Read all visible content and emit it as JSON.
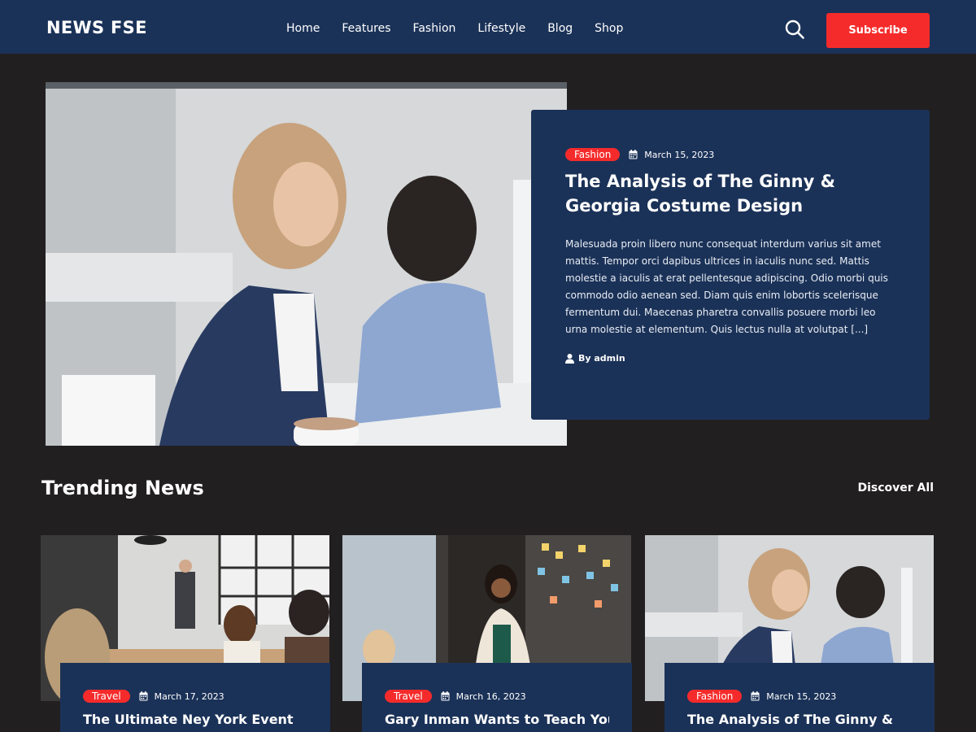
{
  "site": {
    "logo": "NEWS FSE"
  },
  "nav": [
    "Home",
    "Features",
    "Fashion",
    "Lifestyle",
    "Blog",
    "Shop"
  ],
  "header": {
    "subscribe_label": "Subscribe"
  },
  "hero": {
    "category": "Fashion",
    "date": "March 15, 2023",
    "title": "The Analysis of The Ginny & Georgia Costume Design",
    "excerpt": "Malesuada proin libero nunc consequat interdum varius sit amet mattis. Tempor orci dapibus ultrices in iaculis nunc sed. Mattis molestie a iaculis at erat pellentesque adipiscing. Odio morbi quis commodo odio aenean sed. Diam quis enim lobortis scelerisque fermentum dui. Maecenas pharetra convallis posuere morbi leo urna molestie at elementum. Quis lectus nulla at volutpat [...]",
    "author": "By admin"
  },
  "trending": {
    "title": "Trending News",
    "discover_label": "Discover All",
    "cards": [
      {
        "category": "Travel",
        "date": "March 17, 2023",
        "title": "The Ultimate Ney York Event"
      },
      {
        "category": "Travel",
        "date": "March 16, 2023",
        "title": "Gary Inman Wants to Teach You"
      },
      {
        "category": "Fashion",
        "date": "March 15, 2023",
        "title": "The Analysis of The Ginny &"
      }
    ]
  },
  "colors": {
    "header_bg": "#1b3258",
    "page_bg": "#211f20",
    "accent": "#f52b2b",
    "card_bg": "#1b3258"
  },
  "icons": {
    "search": "search-icon",
    "calendar": "calendar-icon",
    "author": "user-icon"
  }
}
